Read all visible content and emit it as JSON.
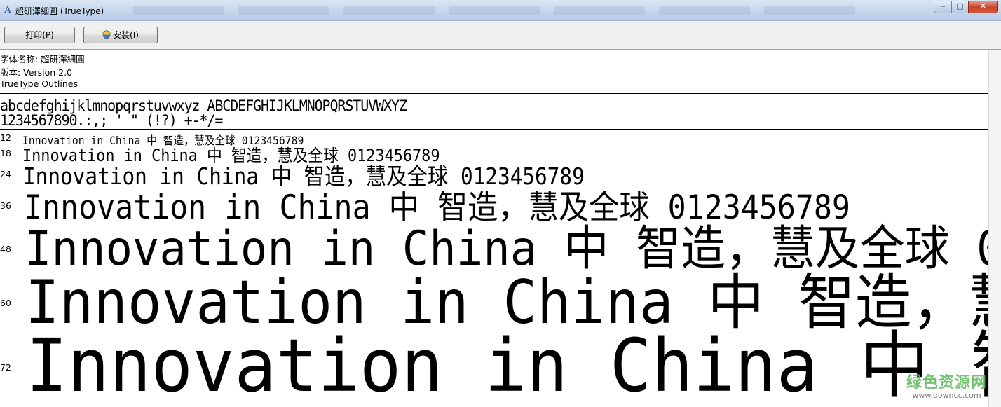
{
  "window": {
    "title": "超研澤細圓 (TrueType)",
    "app_icon": "A",
    "controls": {
      "minimize": "‒",
      "maximize": "□",
      "close": "✕"
    }
  },
  "toolbar": {
    "print_label": "打印(P)",
    "install_label": "安装(I)"
  },
  "font_info": {
    "name_line": "字体名称: 超研澤細圓",
    "version_line": "版本: Version 2.0",
    "outlines_line": "TrueType Outlines"
  },
  "charset": {
    "line1": "abcdefghijklmnopqrstuvwxyz ABCDEFGHIJKLMNOPQRSTUVWXYZ",
    "line2": "1234567890.:,; ' \" (!?) +-*/="
  },
  "sample_text": "Innovation in China 中  智造，慧及全球 0123456789",
  "samples": [
    {
      "size": "12"
    },
    {
      "size": "18"
    },
    {
      "size": "24"
    },
    {
      "size": "36"
    },
    {
      "size": "48"
    },
    {
      "size": "60"
    },
    {
      "size": "72"
    }
  ],
  "watermark": {
    "logo": "绿色资源网",
    "url": "www.downcc.com"
  }
}
